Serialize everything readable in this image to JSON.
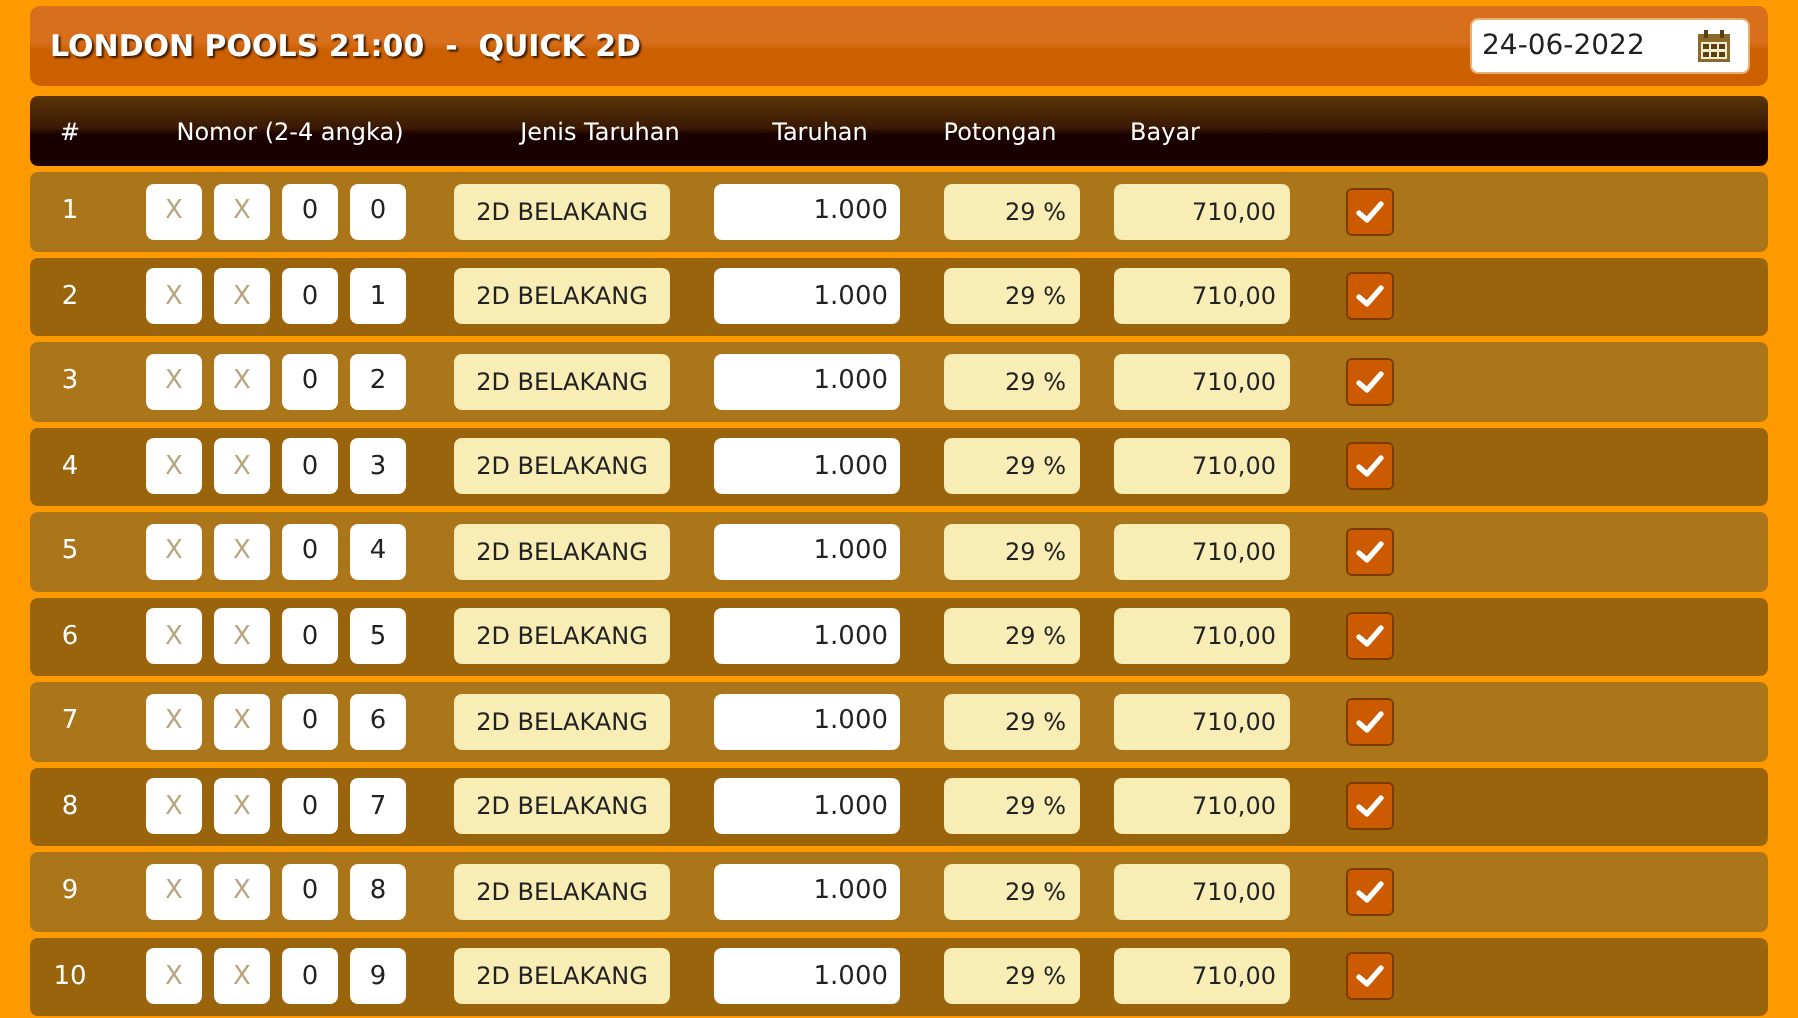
{
  "header": {
    "title": "LONDON POOLS 21:00  -  QUICK 2D",
    "date": "24-06-2022"
  },
  "table": {
    "columns": [
      "#",
      "Nomor (2-4 angka)",
      "Jenis Taruhan",
      "Taruhan",
      "Potongan",
      "Bayar"
    ],
    "rows": [
      {
        "no": "1",
        "digits": [
          {
            "placeholder": "X"
          },
          {
            "placeholder": "X"
          },
          {
            "value": "0"
          },
          {
            "value": "0"
          }
        ],
        "type": "2D BELAKANG",
        "bet": "1.000",
        "discount": "29 %",
        "pay": "710,00",
        "checked": true
      },
      {
        "no": "2",
        "digits": [
          {
            "placeholder": "X"
          },
          {
            "placeholder": "X"
          },
          {
            "value": "0"
          },
          {
            "value": "1"
          }
        ],
        "type": "2D BELAKANG",
        "bet": "1.000",
        "discount": "29 %",
        "pay": "710,00",
        "checked": true
      },
      {
        "no": "3",
        "digits": [
          {
            "placeholder": "X"
          },
          {
            "placeholder": "X"
          },
          {
            "value": "0"
          },
          {
            "value": "2"
          }
        ],
        "type": "2D BELAKANG",
        "bet": "1.000",
        "discount": "29 %",
        "pay": "710,00",
        "checked": true
      },
      {
        "no": "4",
        "digits": [
          {
            "placeholder": "X"
          },
          {
            "placeholder": "X"
          },
          {
            "value": "0"
          },
          {
            "value": "3"
          }
        ],
        "type": "2D BELAKANG",
        "bet": "1.000",
        "discount": "29 %",
        "pay": "710,00",
        "checked": true
      },
      {
        "no": "5",
        "digits": [
          {
            "placeholder": "X"
          },
          {
            "placeholder": "X"
          },
          {
            "value": "0"
          },
          {
            "value": "4"
          }
        ],
        "type": "2D BELAKANG",
        "bet": "1.000",
        "discount": "29 %",
        "pay": "710,00",
        "checked": true
      },
      {
        "no": "6",
        "digits": [
          {
            "placeholder": "X"
          },
          {
            "placeholder": "X"
          },
          {
            "value": "0"
          },
          {
            "value": "5"
          }
        ],
        "type": "2D BELAKANG",
        "bet": "1.000",
        "discount": "29 %",
        "pay": "710,00",
        "checked": true
      },
      {
        "no": "7",
        "digits": [
          {
            "placeholder": "X"
          },
          {
            "placeholder": "X"
          },
          {
            "value": "0"
          },
          {
            "value": "6"
          }
        ],
        "type": "2D BELAKANG",
        "bet": "1.000",
        "discount": "29 %",
        "pay": "710,00",
        "checked": true
      },
      {
        "no": "8",
        "digits": [
          {
            "placeholder": "X"
          },
          {
            "placeholder": "X"
          },
          {
            "value": "0"
          },
          {
            "value": "7"
          }
        ],
        "type": "2D BELAKANG",
        "bet": "1.000",
        "discount": "29 %",
        "pay": "710,00",
        "checked": true
      },
      {
        "no": "9",
        "digits": [
          {
            "placeholder": "X"
          },
          {
            "placeholder": "X"
          },
          {
            "value": "0"
          },
          {
            "value": "8"
          }
        ],
        "type": "2D BELAKANG",
        "bet": "1.000",
        "discount": "29 %",
        "pay": "710,00",
        "checked": true
      },
      {
        "no": "10",
        "digits": [
          {
            "placeholder": "X"
          },
          {
            "placeholder": "X"
          },
          {
            "value": "0"
          },
          {
            "value": "9"
          }
        ],
        "type": "2D BELAKANG",
        "bet": "1.000",
        "discount": "29 %",
        "pay": "710,00",
        "checked": true
      }
    ]
  }
}
